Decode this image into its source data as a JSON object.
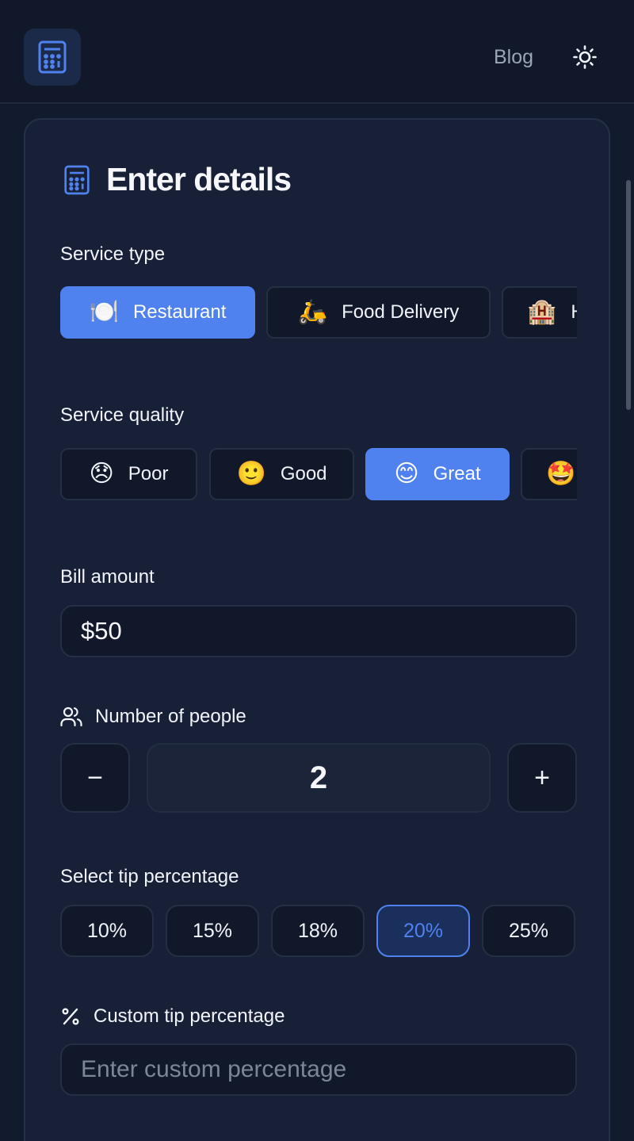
{
  "header": {
    "blog_label": "Blog"
  },
  "card": {
    "title": "Enter details"
  },
  "service_type": {
    "label": "Service type",
    "options": [
      {
        "emoji": "🍽️",
        "label": "Restaurant",
        "selected": true
      },
      {
        "emoji": "🛵",
        "label": "Food Delivery",
        "selected": false
      },
      {
        "emoji": "🏨",
        "label": "H",
        "selected": false
      }
    ]
  },
  "service_quality": {
    "label": "Service quality",
    "options": [
      {
        "emoji": "😞",
        "label": "Poor",
        "selected": false
      },
      {
        "emoji": "🙂",
        "label": "Good",
        "selected": false
      },
      {
        "emoji": "😊",
        "label": "Great",
        "selected": true
      },
      {
        "emoji": "🤩",
        "label": "",
        "selected": false
      }
    ]
  },
  "bill": {
    "label": "Bill amount",
    "value": "$50"
  },
  "people": {
    "label": "Number of people",
    "decrement_label": "−",
    "increment_label": "+",
    "value": "2"
  },
  "tip": {
    "label": "Select tip percentage",
    "options": [
      "10%",
      "15%",
      "18%",
      "20%",
      "25%"
    ],
    "selected": "20%"
  },
  "custom_tip": {
    "label": "Custom tip percentage",
    "placeholder": "Enter custom percentage"
  },
  "colors": {
    "accent": "#4f82ee",
    "background": "#121a2e",
    "card": "#172036"
  },
  "icons": {
    "logo": "calculator-icon",
    "theme": "sun-icon",
    "people": "users-icon",
    "custom": "percent-icon"
  }
}
